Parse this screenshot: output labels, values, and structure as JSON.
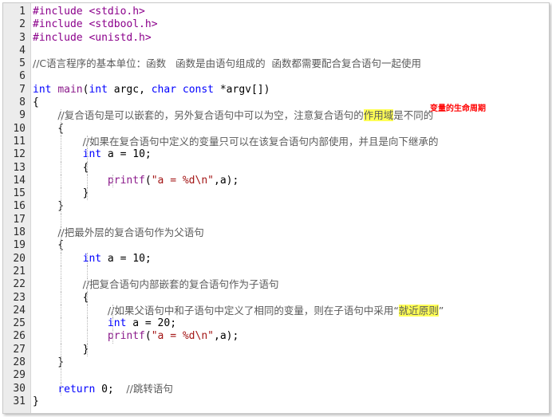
{
  "annotation": "变量的生命周期",
  "lines": [
    {
      "n": "1",
      "parts": [
        {
          "c": "pre",
          "t": "#include <stdio.h>"
        }
      ]
    },
    {
      "n": "2",
      "parts": [
        {
          "c": "pre",
          "t": "#include <stdbool.h>"
        }
      ]
    },
    {
      "n": "3",
      "parts": [
        {
          "c": "pre",
          "t": "#include <unistd.h>"
        }
      ]
    },
    {
      "n": "4",
      "parts": []
    },
    {
      "n": "5",
      "parts": [
        {
          "c": "cm",
          "t": "//C语言程序的基本单位：函数   函数是由语句组成的  函数都需要配合复合语句一起使用"
        }
      ]
    },
    {
      "n": "6",
      "parts": []
    },
    {
      "n": "7",
      "parts": [
        {
          "c": "kw",
          "t": "int"
        },
        {
          "c": "",
          "t": " "
        },
        {
          "c": "fn",
          "t": "main"
        },
        {
          "c": "",
          "t": "("
        },
        {
          "c": "kw",
          "t": "int"
        },
        {
          "c": "",
          "t": " argc, "
        },
        {
          "c": "kw",
          "t": "char const"
        },
        {
          "c": "",
          "t": " *argv[])"
        }
      ]
    },
    {
      "n": "8",
      "parts": [
        {
          "c": "",
          "t": "{"
        }
      ]
    },
    {
      "n": "9",
      "parts": [
        {
          "c": "",
          "t": "    "
        },
        {
          "c": "cm",
          "t": "//复合语句是可以嵌套的，另外复合语句中可以为空，注意复合语句的"
        },
        {
          "c": "cm hl",
          "t": "作用域"
        },
        {
          "c": "cm",
          "t": "是不同的"
        }
      ]
    },
    {
      "n": "10",
      "parts": [
        {
          "c": "",
          "t": "    {"
        }
      ]
    },
    {
      "n": "11",
      "parts": [
        {
          "c": "",
          "t": "        "
        },
        {
          "c": "cm",
          "t": "//如果在复合语句中定义的变量只可以在该复合语句内部使用，并且是向下继承的"
        }
      ]
    },
    {
      "n": "12",
      "parts": [
        {
          "c": "",
          "t": "        "
        },
        {
          "c": "kw",
          "t": "int"
        },
        {
          "c": "",
          "t": " a = 10;"
        }
      ]
    },
    {
      "n": "13",
      "parts": [
        {
          "c": "",
          "t": "        {"
        }
      ]
    },
    {
      "n": "14",
      "parts": [
        {
          "c": "",
          "t": "            "
        },
        {
          "c": "fn",
          "t": "printf"
        },
        {
          "c": "",
          "t": "("
        },
        {
          "c": "str",
          "t": "\"a = %d\\n\""
        },
        {
          "c": "",
          "t": ",a);"
        }
      ]
    },
    {
      "n": "15",
      "parts": [
        {
          "c": "",
          "t": "        }"
        }
      ]
    },
    {
      "n": "16",
      "parts": [
        {
          "c": "",
          "t": "    }"
        }
      ]
    },
    {
      "n": "17",
      "parts": []
    },
    {
      "n": "18",
      "parts": [
        {
          "c": "",
          "t": "    "
        },
        {
          "c": "cm",
          "t": "//把最外层的复合语句作为父语句"
        }
      ]
    },
    {
      "n": "19",
      "parts": [
        {
          "c": "",
          "t": "    {"
        }
      ]
    },
    {
      "n": "20",
      "parts": [
        {
          "c": "",
          "t": "        "
        },
        {
          "c": "kw",
          "t": "int"
        },
        {
          "c": "",
          "t": " a = 10;"
        }
      ]
    },
    {
      "n": "21",
      "parts": []
    },
    {
      "n": "22",
      "parts": [
        {
          "c": "",
          "t": "        "
        },
        {
          "c": "cm",
          "t": "//把复合语句内部嵌套的复合语句作为子语句"
        }
      ]
    },
    {
      "n": "23",
      "parts": [
        {
          "c": "",
          "t": "        {"
        }
      ]
    },
    {
      "n": "24",
      "parts": [
        {
          "c": "",
          "t": "            "
        },
        {
          "c": "cm",
          "t": "//如果父语句中和子语句中定义了相同的变量，则在子语句中采用“"
        },
        {
          "c": "cm hl",
          "t": "就近原则"
        },
        {
          "c": "cm",
          "t": "”"
        }
      ]
    },
    {
      "n": "25",
      "parts": [
        {
          "c": "",
          "t": "            "
        },
        {
          "c": "kw",
          "t": "int"
        },
        {
          "c": "",
          "t": " a = 20;"
        }
      ]
    },
    {
      "n": "26",
      "parts": [
        {
          "c": "",
          "t": "            "
        },
        {
          "c": "fn",
          "t": "printf"
        },
        {
          "c": "",
          "t": "("
        },
        {
          "c": "str",
          "t": "\"a = %d\\n\""
        },
        {
          "c": "",
          "t": ",a);"
        }
      ]
    },
    {
      "n": "27",
      "parts": [
        {
          "c": "",
          "t": "        }"
        }
      ]
    },
    {
      "n": "28",
      "parts": [
        {
          "c": "",
          "t": "    }"
        }
      ]
    },
    {
      "n": "29",
      "parts": []
    },
    {
      "n": "30",
      "parts": [
        {
          "c": "",
          "t": "    "
        },
        {
          "c": "kw",
          "t": "return"
        },
        {
          "c": "",
          "t": " 0;  "
        },
        {
          "c": "cm",
          "t": "//跳转语句"
        }
      ]
    },
    {
      "n": "31",
      "parts": [
        {
          "c": "",
          "t": "}"
        }
      ]
    }
  ]
}
